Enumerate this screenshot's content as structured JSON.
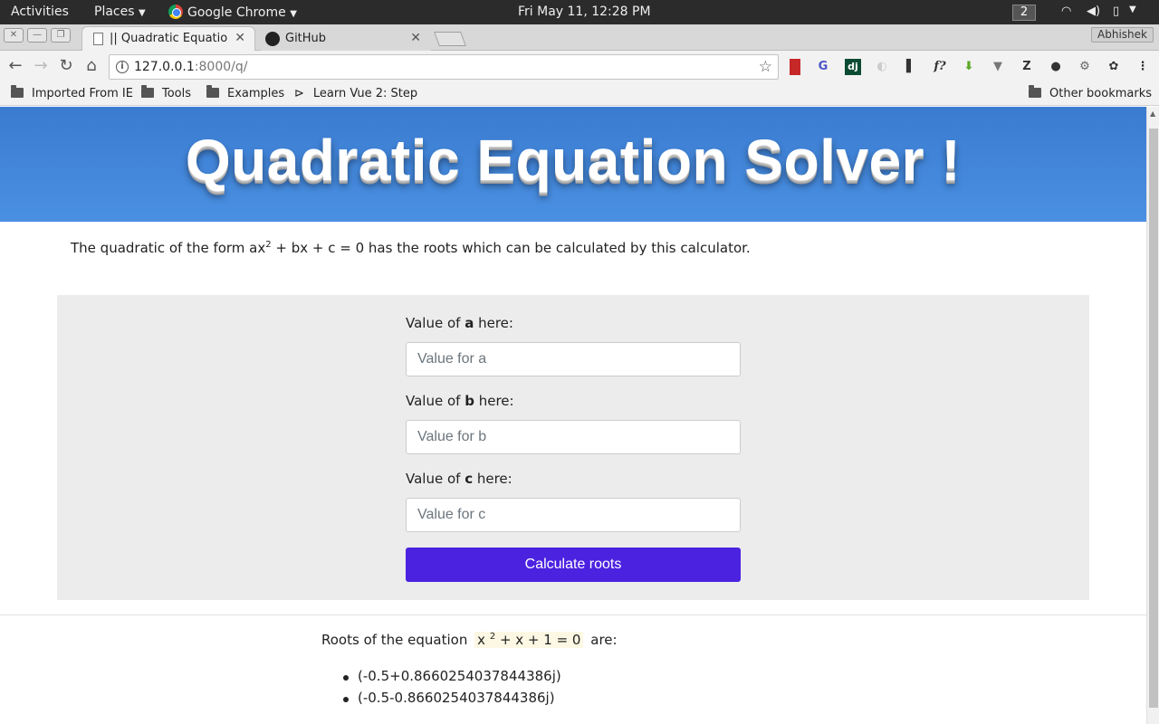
{
  "os_bar": {
    "activities": "Activities",
    "places": "Places",
    "app_menu": "Google Chrome",
    "clock": "Fri May 11, 12:28 PM",
    "workspace": "2"
  },
  "browser": {
    "profile": "Abhishek",
    "tabs": [
      {
        "label": "|| Quadratic Equation S",
        "active": true
      },
      {
        "label": "GitHub",
        "active": false
      }
    ],
    "url_host": "127.0.0.1",
    "url_path": ":8000/q/",
    "extensions": [
      "book-icon",
      "translate-icon",
      "dj",
      "blank-icon",
      "panel-icon",
      "f?",
      "download-icon",
      "v-icon",
      "Z",
      "bulb-icon",
      "gear-icon",
      "gnome-icon"
    ],
    "bookmarks": [
      "Imported From IE",
      "Tools",
      "Examples",
      "Learn Vue 2: Step"
    ],
    "other_bookmarks": "Other bookmarks"
  },
  "page": {
    "title": "Quadratic Equation Solver !",
    "intro_before": "The quadratic of the form ax",
    "intro_sup": "2",
    "intro_after": " + bx + c = 0 has the roots which can be calculated by this calculator.",
    "fields": [
      {
        "label_prefix": "Value of ",
        "var": "a",
        "label_suffix": " here:",
        "placeholder": "Value for a"
      },
      {
        "label_prefix": "Value of ",
        "var": "b",
        "label_suffix": " here:",
        "placeholder": "Value for b"
      },
      {
        "label_prefix": "Value of ",
        "var": "c",
        "label_suffix": " here:",
        "placeholder": "Value for c"
      }
    ],
    "button": "Calculate roots",
    "result_prefix": "Roots of the equation",
    "eq_base": "x ",
    "eq_sup": "2",
    "eq_rest": " + x + 1 = 0",
    "result_suffix": "are:",
    "roots": [
      "(-0.5+0.8660254037844386j)",
      "(-0.5-0.8660254037844386j)"
    ]
  },
  "colors": {
    "hero_top": "#3a7bd0",
    "hero_bottom": "#4a90e2",
    "button": "#4b22e0",
    "panel": "#ececec",
    "equation_highlight": "#fcf8e3"
  }
}
